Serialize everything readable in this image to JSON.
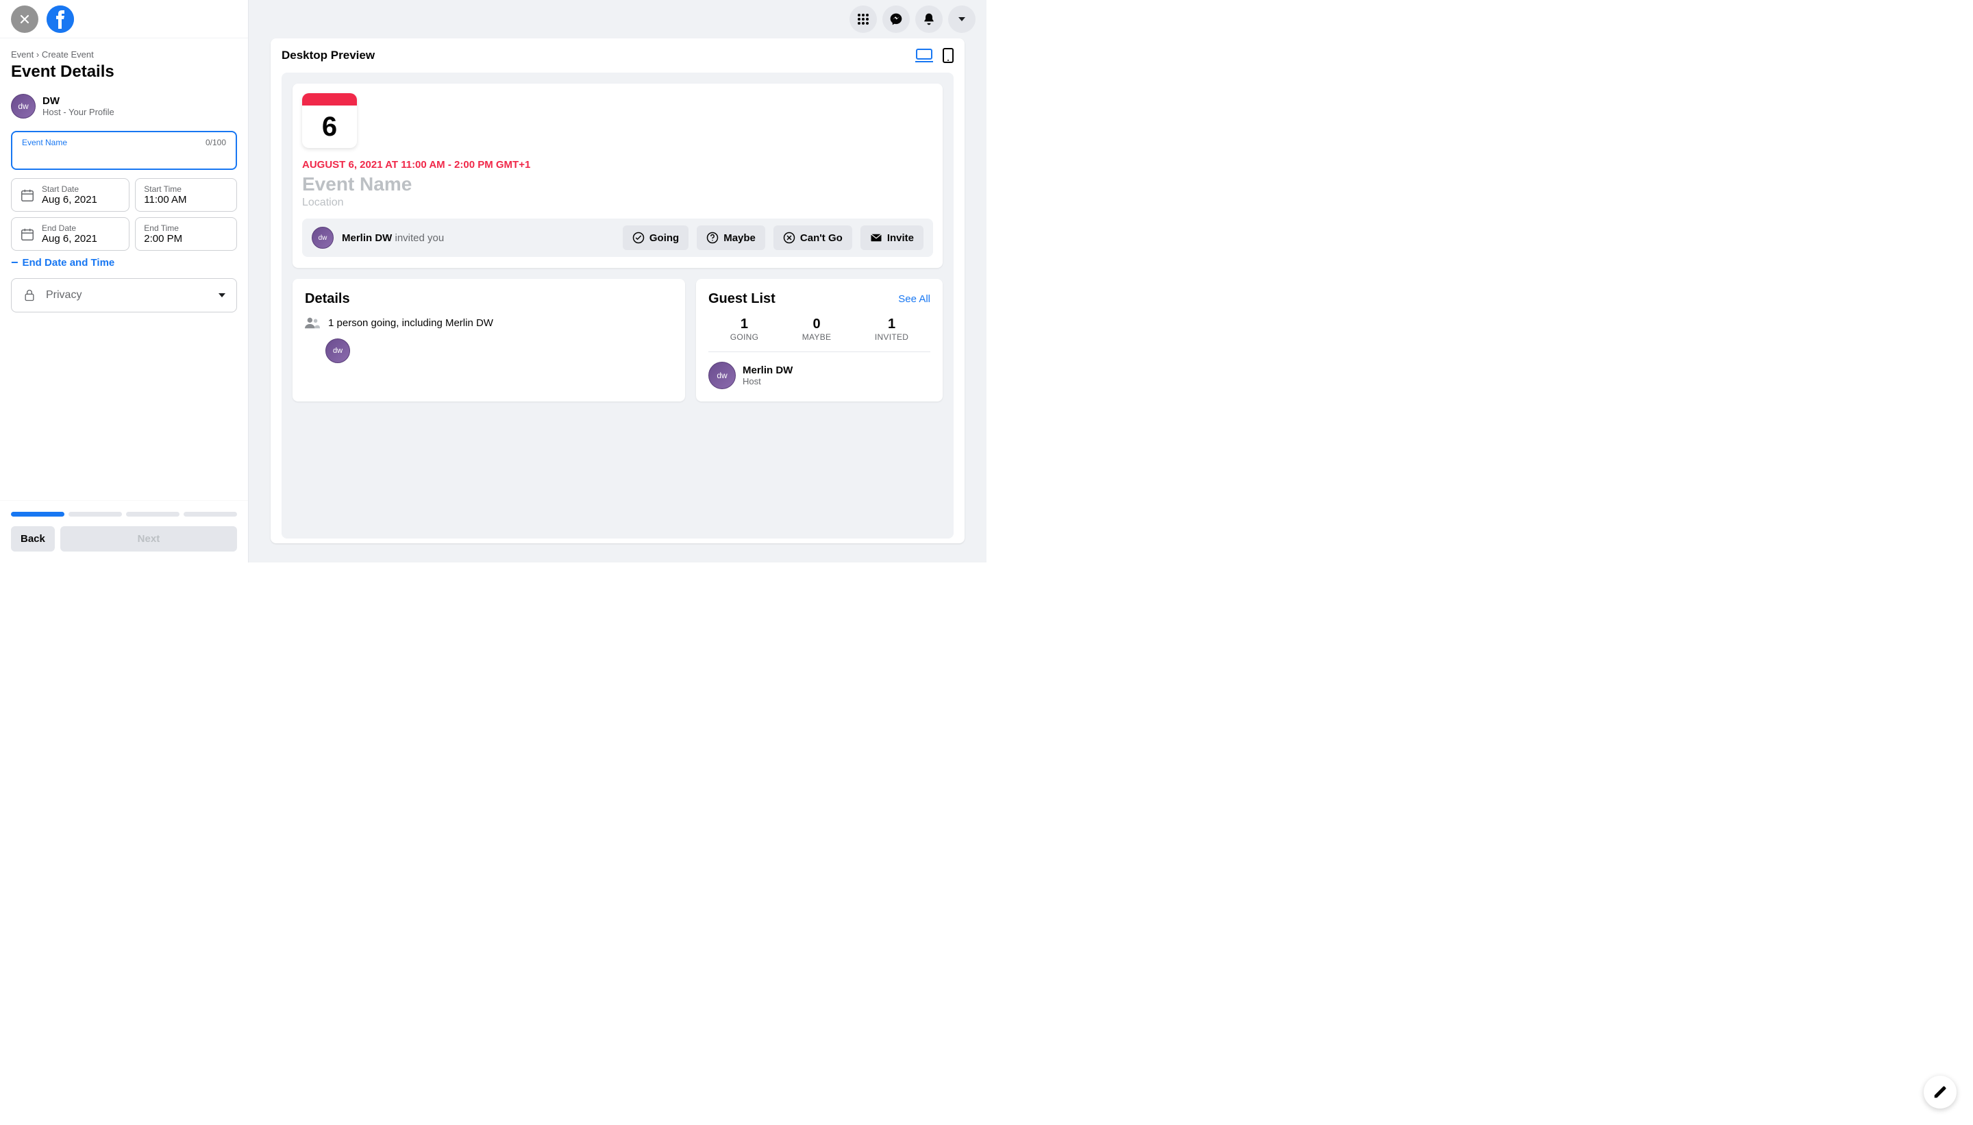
{
  "breadcrumb": {
    "event": "Event",
    "sep": "›",
    "create": "Create Event"
  },
  "page_title": "Event Details",
  "host": {
    "avatar_text": "dw",
    "name": "DW",
    "role": "Host - Your Profile"
  },
  "event_name": {
    "label": "Event Name",
    "counter": "0/100",
    "value": ""
  },
  "dates": {
    "start_date_label": "Start Date",
    "start_date": "Aug 6, 2021",
    "start_time_label": "Start Time",
    "start_time": "11:00 AM",
    "end_date_label": "End Date",
    "end_date": "Aug 6, 2021",
    "end_time_label": "End Time",
    "end_time": "2:00 PM"
  },
  "end_toggle": "End Date and Time",
  "privacy_label": "Privacy",
  "footer": {
    "back": "Back",
    "next": "Next"
  },
  "preview": {
    "title": "Desktop Preview",
    "cal_day": "6",
    "date_line": "AUGUST 6, 2021 AT 11:00 AM - 2:00 PM GMT+1",
    "event_name_placeholder": "Event Name",
    "location_placeholder": "Location",
    "inviter": "Merlin DW",
    "invite_suffix": " invited you",
    "rsvp": {
      "going": "Going",
      "maybe": "Maybe",
      "cant": "Can't Go",
      "invite": "Invite"
    },
    "details_title": "Details",
    "going_text": "1 person going, including Merlin DW",
    "guest_title": "Guest List",
    "see_all": "See All",
    "counts": {
      "going_n": "1",
      "going_l": "GOING",
      "maybe_n": "0",
      "maybe_l": "MAYBE",
      "invited_n": "1",
      "invited_l": "INVITED"
    },
    "guest": {
      "name": "Merlin DW",
      "role": "Host",
      "avatar_text": "dw"
    }
  }
}
